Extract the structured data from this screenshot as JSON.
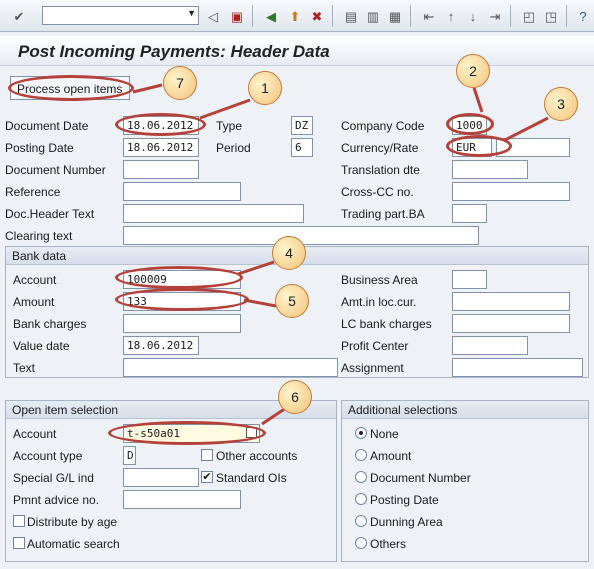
{
  "toolbar": {
    "command_field_value": "",
    "icons": [
      "enter-icon",
      "back-icon",
      "save-icon",
      "exit-icon",
      "cancel-icon",
      "print-icon",
      "find-icon",
      "find-next-icon",
      "first-page-icon",
      "prev-page-icon",
      "next-page-icon",
      "last-page-icon",
      "new-session-icon",
      "shortcut-icon",
      "help-icon"
    ]
  },
  "title": "Post Incoming Payments: Header Data",
  "process_open_items": "Process open items",
  "header": {
    "document_date_label": "Document Date",
    "document_date": "18.06.2012",
    "type_label": "Type",
    "type": "DZ",
    "company_code_label": "Company Code",
    "company_code": "1000",
    "posting_date_label": "Posting Date",
    "posting_date": "18.06.2012",
    "period_label": "Period",
    "period": "6",
    "currency_label": "Currency/Rate",
    "currency": "EUR",
    "rate": "",
    "document_number_label": "Document Number",
    "document_number": "",
    "translation_date_label": "Translation dte",
    "translation_date": "",
    "reference_label": "Reference",
    "reference": "",
    "cross_cc_label": "Cross-CC no.",
    "cross_cc": "",
    "doc_header_text_label": "Doc.Header Text",
    "doc_header_text": "",
    "trading_part_label": "Trading part.BA",
    "trading_part": "",
    "clearing_text_label": "Clearing text",
    "clearing_text": ""
  },
  "bank_data": {
    "title": "Bank data",
    "account_label": "Account",
    "account": "100009",
    "business_area_label": "Business Area",
    "business_area": "",
    "amount_label": "Amount",
    "amount": "133",
    "amt_loc_label": "Amt.in loc.cur.",
    "amt_loc": "",
    "bank_charges_label": "Bank charges",
    "bank_charges": "",
    "lc_bank_charges_label": "LC bank charges",
    "lc_bank_charges": "",
    "value_date_label": "Value date",
    "value_date": "18.06.2012",
    "profit_center_label": "Profit Center",
    "profit_center": "",
    "text_label": "Text",
    "text": "",
    "assignment_label": "Assignment",
    "assignment": ""
  },
  "open_items": {
    "title": "Open item selection",
    "account_label": "Account",
    "account": "t-s50a01",
    "account_type_label": "Account type",
    "account_type": "D",
    "other_accounts_label": "Other accounts",
    "special_gl_label": "Special G/L ind",
    "special_gl": "",
    "standard_ois_label": "Standard OIs",
    "pmnt_advice_label": "Pmnt advice no.",
    "pmnt_advice": "",
    "distribute_label": "Distribute by age",
    "automatic_label": "Automatic search",
    "check_mark": "✔"
  },
  "additional": {
    "title": "Additional selections",
    "options": [
      "None",
      "Amount",
      "Document Number",
      "Posting Date",
      "Dunning Area",
      "Others"
    ]
  },
  "callouts": [
    "1",
    "2",
    "3",
    "4",
    "5",
    "6",
    "7"
  ],
  "colors": {
    "highlight_ring": "#b4413a",
    "callout_fill": "#f3c27a"
  }
}
